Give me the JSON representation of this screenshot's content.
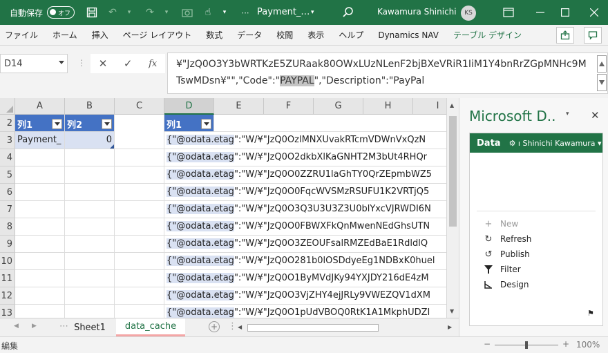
{
  "titlebar": {
    "autosave_label": "自動保存",
    "autosave_state": "オフ",
    "doc_title": "Payment_…",
    "user_name": "Kawamura Shinichi",
    "user_initials": "KS"
  },
  "ribbon": {
    "tabs": [
      "ファイル",
      "ホーム",
      "挿入",
      "ページ レイアウト",
      "数式",
      "データ",
      "校閲",
      "表示",
      "ヘルプ",
      "Dynamics NAV",
      "テーブル デザイン"
    ]
  },
  "formula_bar": {
    "name_box": "D14",
    "fx": "fx",
    "line1": "¥\"JzQ0O3Y3bWRTKzE5ZURaak80OWxLUzNLenF2bjBXeVRiR1IiM1Y4bnRrZGpMNHc9M",
    "line2_pre": "TswMDsn¥\"\",\"Code\":\"",
    "line2_hl": "PAYPAL",
    "line2_post": "\",\"Description\":\"PayPal"
  },
  "grid": {
    "columns": [
      "A",
      "B",
      "C",
      "D",
      "E",
      "F",
      "G",
      "H",
      "I"
    ],
    "rows": [
      "2",
      "3",
      "4",
      "5",
      "6",
      "7",
      "8",
      "9",
      "10",
      "11",
      "12",
      "13"
    ],
    "table1": {
      "h1": "列1",
      "h2": "列2",
      "a3": "Payment_",
      "b3": "0"
    },
    "table2": {
      "h1": "列1"
    },
    "d_rows": [
      {
        "tag": "{\"@odata.etag",
        "rest": "\":\"W/¥\"JzQ0OzlMNXUvakRTcmVDWnVxQzN"
      },
      {
        "tag": "{\"@odata.etag",
        "rest": "\":\"W/¥\"JzQ0O2dkbXlKaGNHT2M3bUt4RHQr"
      },
      {
        "tag": "{\"@odata.etag",
        "rest": "\":\"W/¥\"JzQ0O0ZZRU1laGhTY0QrZEpmbWZ5"
      },
      {
        "tag": "{\"@odata.etag",
        "rest": "\":\"W/¥\"JzQ0O0FqcWVSMzRSUFU1K2VRTjQ5"
      },
      {
        "tag": "{\"@odata.etag",
        "rest": "\":\"W/¥\"JzQ0O3Q3U3U3Z3U0blYxcVJRWDI6N"
      },
      {
        "tag": "{\"@odata.etag",
        "rest": "\":\"W/¥\"JzQ0O0FBWXFkQnMwenNEdGhsUTN"
      },
      {
        "tag": "{\"@odata.etag",
        "rest": "\":\"W/¥\"JzQ0O3ZEOUFsalRMZEdBaE1RdldlQ"
      },
      {
        "tag": "{\"@odata.etag",
        "rest": "\":\"W/¥\"JzQ0O281b0lOSDdyeEg1NDBxK0huel"
      },
      {
        "tag": "{\"@odata.etag",
        "rest": "\":\"W/¥\"JzQ0O1ByMVdJKy94YXJDY216dE4zM"
      },
      {
        "tag": "{\"@odata.etag",
        "rest": "\":\"W/¥\"JzQ0O3VjZHY4ejJRLy9VWEZQV1dXM"
      },
      {
        "tag": "{\"@odata.etag",
        "rest": "\":\"W/¥\"JzQ0O1pUdVBOQ0RtK1A1MkphUDZI"
      }
    ]
  },
  "sheets": {
    "tab1": "Sheet1",
    "tab2": "data_cache"
  },
  "status": {
    "mode": "編集",
    "zoom": "100%"
  },
  "pane": {
    "title": "Microsoft D..",
    "data_label": "Data",
    "user": "Shinichi Kawamura",
    "actions": {
      "new": "New",
      "refresh": "Refresh",
      "publish": "Publish",
      "filter": "Filter",
      "design": "Design"
    }
  },
  "colors": {
    "excel_green": "#217346",
    "table_header": "#4472c4",
    "table_band": "#d9e1f2"
  }
}
